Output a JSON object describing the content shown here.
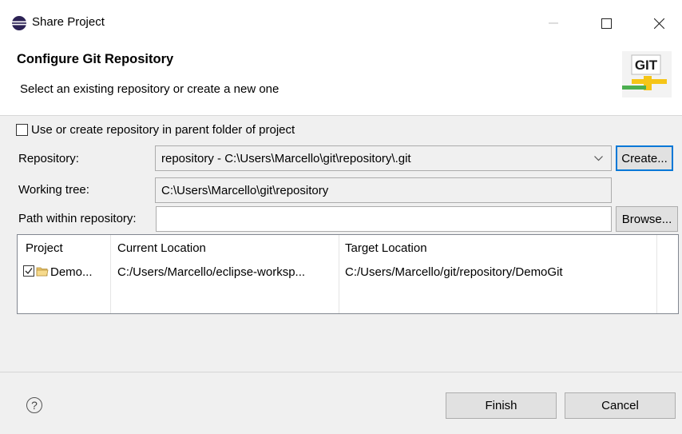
{
  "window": {
    "title": "Share Project"
  },
  "header": {
    "title": "Configure Git Repository",
    "description": "Select an existing repository or create a new one",
    "logo_text": "GIT"
  },
  "form": {
    "parent_folder_checkbox_label": "Use or create repository in parent folder of project",
    "parent_folder_checked": false,
    "repository_label": "Repository:",
    "repository_value": "repository - C:\\Users\\Marcello\\git\\repository\\.git",
    "create_button": "Create...",
    "working_tree_label": "Working tree:",
    "working_tree_value": "C:\\Users\\Marcello\\git\\repository",
    "path_label": "Path within repository:",
    "path_value": "",
    "browse_button": "Browse..."
  },
  "table": {
    "columns": [
      "Project",
      "Current Location",
      "Target Location"
    ],
    "rows": [
      {
        "checked": true,
        "project": "Demo...",
        "current_location": "C:/Users/Marcello/eclipse-worksp...",
        "target_location": "C:/Users/Marcello/git/repository/DemoGit"
      }
    ]
  },
  "footer": {
    "help_symbol": "?",
    "finish_button": "Finish",
    "cancel_button": "Cancel"
  },
  "colors": {
    "accent": "#0078d7",
    "dialog_bg": "#f0f0f0",
    "git_logo_text": "#1a1a1a",
    "git_logo_green": "#4caf50",
    "git_logo_yellow": "#f5c518"
  }
}
